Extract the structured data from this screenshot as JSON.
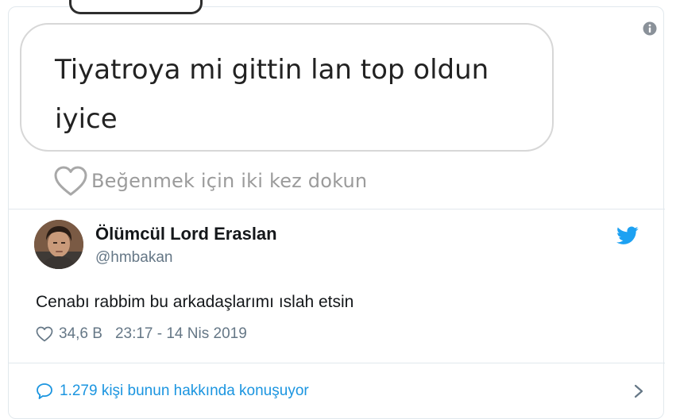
{
  "embedded_screenshot": {
    "message_text": "Tiyatroya mi gittin lan top oldun iyice",
    "like_hint": "Beğenmek için iki kez dokun"
  },
  "tweet": {
    "display_name": "Ölümcül Lord Eraslan",
    "handle": "@hmbakan",
    "text": "Cenabı rabbim bu arkadaşlarımı ıslah etsin",
    "likes": "34,6 B",
    "timestamp": "23:17 - 14 Nis 2019",
    "conversation_link": "1.279 kişi bunun hakkında konuşuyor"
  },
  "icons": {
    "info": "info-icon",
    "bird": "twitter-bird-icon",
    "heart": "heart-icon",
    "reply": "speech-bubble-icon",
    "chevron": "chevron-right-icon"
  },
  "colors": {
    "twitter_blue": "#1da1f2",
    "link_blue": "#1b95e0",
    "secondary_text": "#657786",
    "primary_text": "#14171a",
    "border": "#e1e8ed"
  }
}
